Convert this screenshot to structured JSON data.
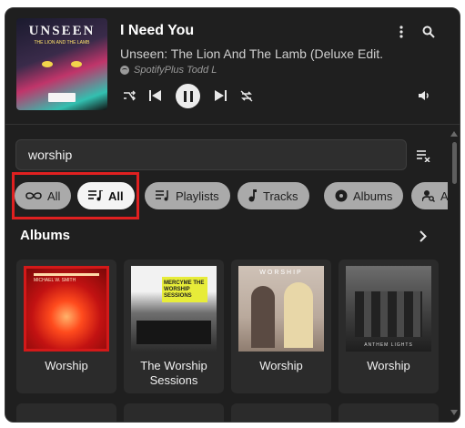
{
  "player": {
    "cover": {
      "title": "UNSEEN",
      "subtitle": "THE LION AND THE LAMB"
    },
    "track_title": "I Need You",
    "album": "Unseen: The Lion And The Lamb (Deluxe Edit...",
    "source": "SpotifyPlus Todd L",
    "icons": [
      "more-vert-icon",
      "search-icon",
      "shuffle-icon",
      "skip-previous-icon",
      "pause-icon",
      "skip-next-icon",
      "repeat-off-icon",
      "volume-icon"
    ]
  },
  "search": {
    "value": "worship",
    "placeholder": "",
    "clear_icon": "clear-list-icon"
  },
  "filters": [
    {
      "label": "All",
      "icon": "infinity-icon"
    },
    {
      "label": "All",
      "icon": "playlist-music-icon",
      "active": true
    },
    {
      "label": "Playlists",
      "icon": "playlist-icon"
    },
    {
      "label": "Tracks",
      "icon": "music-note-icon"
    },
    {
      "label": "Albums",
      "icon": "album-icon"
    },
    {
      "label": "Ar",
      "icon": "artist-search-icon"
    }
  ],
  "albums_section": {
    "title": "Albums",
    "items": [
      {
        "name": "Worship",
        "art_text": "MICHAEL W. SMITH"
      },
      {
        "name": "The Worship Sessions",
        "art_text": "MERCYME THE WORSHIP SESSIONS"
      },
      {
        "name": "Worship",
        "art_text": "WORSHIP"
      },
      {
        "name": "Worship",
        "art_text": "ANTHEM LIGHTS"
      }
    ]
  },
  "colors": {
    "background": "#1f1f1f",
    "chip": "#aaaaaa",
    "chip_active": "#f4f4f4",
    "highlight": "#e02020"
  }
}
